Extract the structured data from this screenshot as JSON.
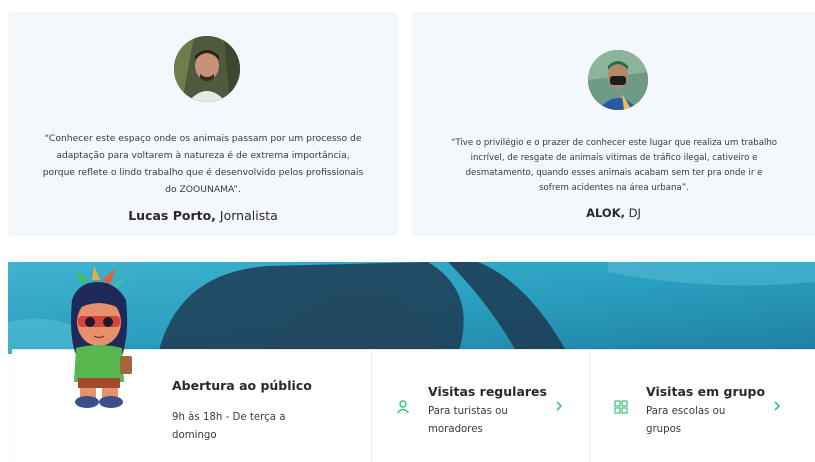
{
  "testimonials": [
    {
      "quote": "“Conhecer este espaço onde os animais passam por um processo de adaptação para voltarem à natureza é de extrema importância, porque reflete o lindo trabalho que é desenvolvido pelos profissionais do ZOOUNAMA”.",
      "author_name": "Lucas Porto,",
      "author_role": "Jornalista"
    },
    {
      "quote": "“Tive o privilégio e o prazer de conhecer este lugar que realiza um trabalho incrível, de resgate de animais vitimas de tráfico ilegal, cativeiro e desmatamento, quando esses animais acabam sem ter pra onde ir e sofrem acidentes na área urbana”.",
      "author_name": "ALOK,",
      "author_role": "DJ"
    }
  ],
  "opening": {
    "title": "Abertura ao público",
    "hours": "9h às 18h - De terça a domingo"
  },
  "visits": [
    {
      "title": "Visitas regulares",
      "description": "Para turistas ou moradores",
      "icon": "person-icon"
    },
    {
      "title": "Visitas em grupo",
      "description": "Para escolas ou grupos",
      "icon": "grid-icon"
    }
  ],
  "colors": {
    "accent": "#3fbf7f",
    "card_bg": "#f4f7fb",
    "water": "#2a9fbf"
  }
}
